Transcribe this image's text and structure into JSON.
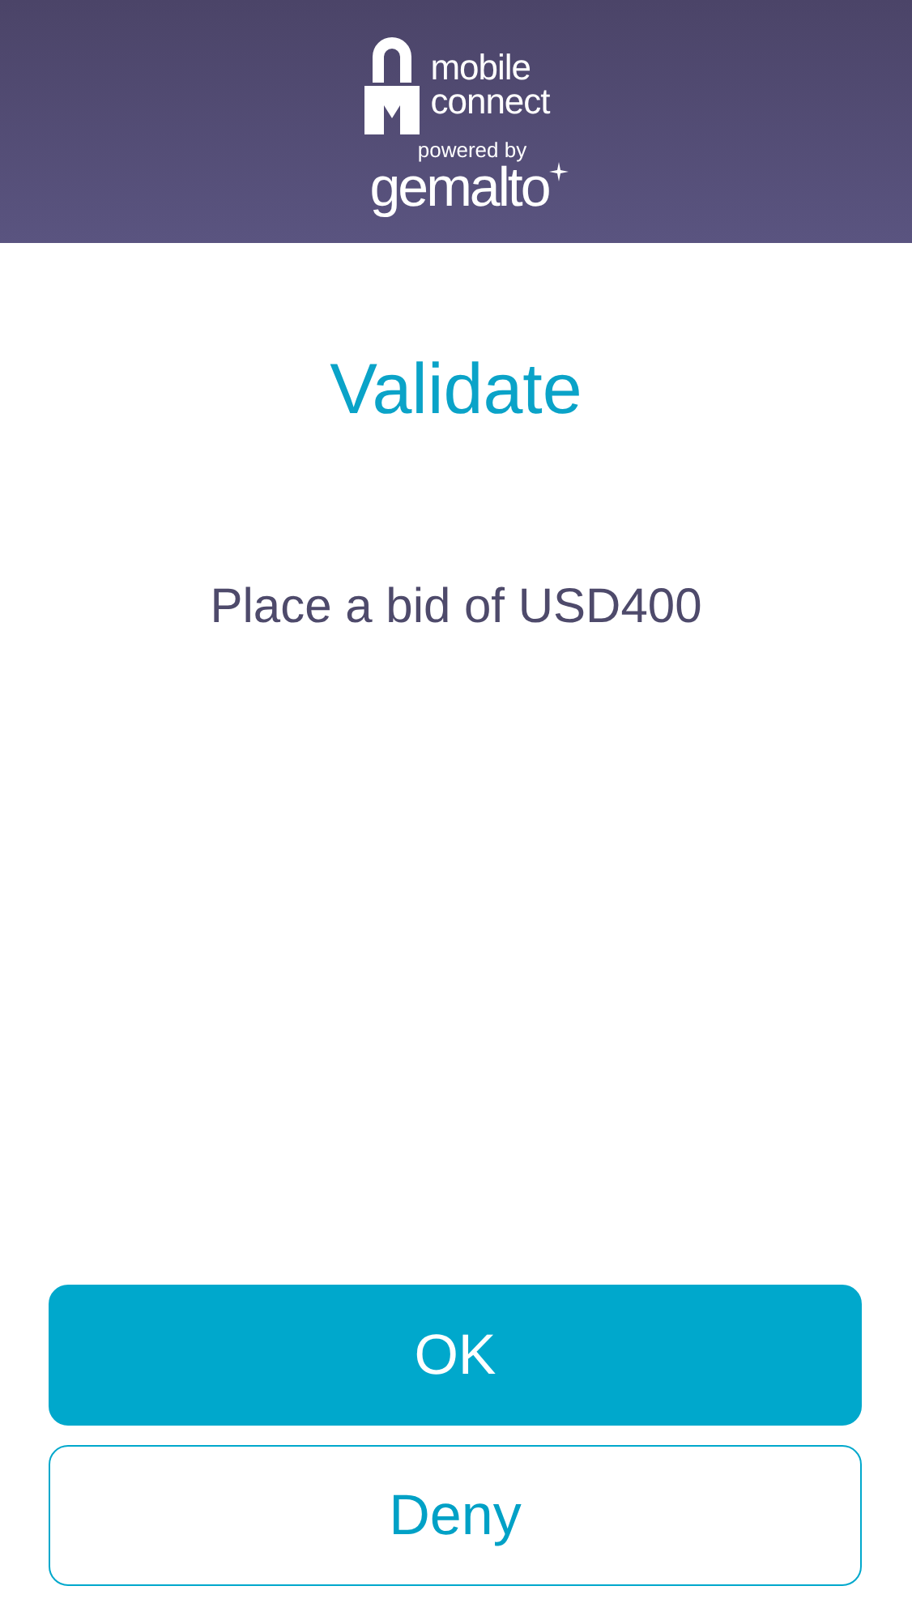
{
  "header": {
    "brand_line_1": "mobile",
    "brand_line_2": "connect",
    "powered_by": "powered by",
    "vendor": "gemalto"
  },
  "title": "Validate",
  "message": "Place a bid of USD400",
  "buttons": [
    {
      "label": "OK",
      "kind": "primary"
    },
    {
      "label": "Deny",
      "kind": "secondary"
    }
  ]
}
